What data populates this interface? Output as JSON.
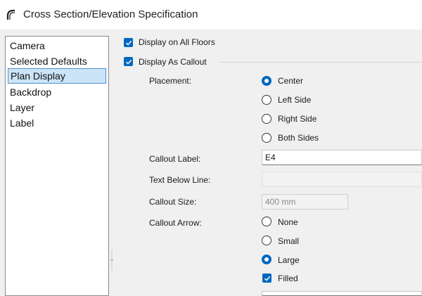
{
  "window": {
    "title": "Cross Section/Elevation Specification",
    "icon": "arch-icon"
  },
  "sidebar": {
    "items": [
      {
        "label": "Camera",
        "selected": false
      },
      {
        "label": "Selected Defaults",
        "selected": false
      },
      {
        "label": "Plan Display",
        "selected": true
      },
      {
        "label": "Backdrop",
        "selected": false
      },
      {
        "label": "Layer",
        "selected": false
      },
      {
        "label": "Label",
        "selected": false
      }
    ]
  },
  "main": {
    "display_on_all_floors": {
      "label": "Display on All Floors",
      "checked": true
    },
    "display_as_callout": {
      "label": "Display As Callout",
      "checked": true
    },
    "placement": {
      "label": "Placement:",
      "options": [
        "Center",
        "Left Side",
        "Right Side",
        "Both Sides"
      ],
      "selected": "Center"
    },
    "callout_label": {
      "label": "Callout Label:",
      "value": "E4"
    },
    "text_below_line": {
      "label": "Text Below Line:",
      "value": ""
    },
    "callout_size": {
      "label": "Callout Size:",
      "value": "400 mm"
    },
    "callout_arrow": {
      "label": "Callout Arrow:",
      "options": [
        "None",
        "Small",
        "Large"
      ],
      "selected": "Large"
    },
    "filled": {
      "label": "Filled",
      "checked": true
    }
  },
  "colors": {
    "accent": "#0067c0",
    "selection_bg": "#cce4f7",
    "selection_border": "#4d90cf"
  }
}
